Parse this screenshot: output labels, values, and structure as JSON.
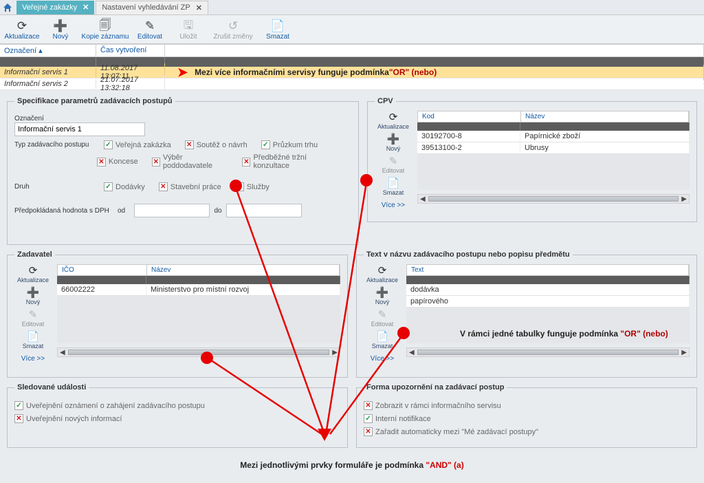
{
  "tabs": {
    "active": "Veřejné zakázky",
    "inactive": "Nastavení vyhledávání ZP"
  },
  "toolbar": {
    "aktualizace": "Aktualizace",
    "novy": "Nový",
    "kopie": "Kopie záznamu",
    "editovat": "Editovat",
    "ulozit": "Uložit",
    "zrusit": "Zrušit změny",
    "smazat": "Smazat"
  },
  "grid": {
    "th_oznaceni": "Označení",
    "th_vytvoreni": "Čas vytvoření",
    "rows": [
      {
        "oz": "Informační servis 1",
        "cv": "11.08.2017 13:07:11"
      },
      {
        "oz": "Informační servis 2",
        "cv": "21.07.2017 13:32:18"
      }
    ]
  },
  "note_or_top_black": "Mezi více informačními servisy funguje podmínka ",
  "note_or_top_red": "\"OR\" (nebo)",
  "spec": {
    "legend": "Specifikace parametrů zadávacích postupů",
    "oznaceni_lbl": "Označení",
    "oznaceni_val": "Informační servis 1",
    "typ_lbl": "Typ zadávacího postupu",
    "chk_verejna": "Veřejná zakázka",
    "chk_soutez": "Soutěž o návrh",
    "chk_pruzkum": "Průzkum trhu",
    "chk_koncese": "Koncese",
    "chk_vyber": "Výběr poddodavatele",
    "chk_predbezne": "Předběžné tržní konzultace",
    "druh_lbl": "Druh",
    "chk_dodavky": "Dodávky",
    "chk_stavebni": "Stavební práce",
    "chk_sluzby": "Služby",
    "hodnota_lbl": "Předpokládaná hodnota s DPH",
    "od": "od",
    "do": "do"
  },
  "cpv": {
    "legend": "CPV",
    "th_kod": "Kod",
    "th_nazev": "Název",
    "rows": [
      {
        "kod": "30192700-8",
        "nazev": "Papírnické zboží"
      },
      {
        "kod": "39513100-2",
        "nazev": "Ubrusy"
      }
    ],
    "side": {
      "aktualizace": "Aktualizace",
      "novy": "Nový",
      "editovat": "Editovat",
      "smazat": "Smazat",
      "vice": "Více >>"
    }
  },
  "zadavatel": {
    "legend": "Zadavatel",
    "th_ico": "IČO",
    "th_nazev": "Název",
    "rows": [
      {
        "ico": "66002222",
        "nazev": "Ministerstvo pro místní rozvoj"
      }
    ]
  },
  "textpanel": {
    "legend": "Text v názvu zadávacího postupu nebo popisu předmětu",
    "th_text": "Text",
    "rows": [
      {
        "t": "dodávka"
      },
      {
        "t": "papírového"
      }
    ]
  },
  "note_table_black": "V rámci jedné tabulky funguje podmínka ",
  "note_table_red": "\"OR\" (nebo)",
  "sledovane": {
    "legend": "Sledované události",
    "chk1": "Uveřejnění oznámení o zahájení zadávacího postupu",
    "chk2": "Uveřejnění nových informací"
  },
  "forma": {
    "legend": "Forma upozornění na zadávací postup",
    "chk1": "Zobrazit v rámci informačního servisu",
    "chk2": "Interní notifikace",
    "chk3": "Zařadit automaticky mezi \"Mé zadávací postupy\""
  },
  "bottom_black": "Mezi jednotlivými prvky formuláře je podmínka ",
  "bottom_red": "\"AND\" (a)"
}
